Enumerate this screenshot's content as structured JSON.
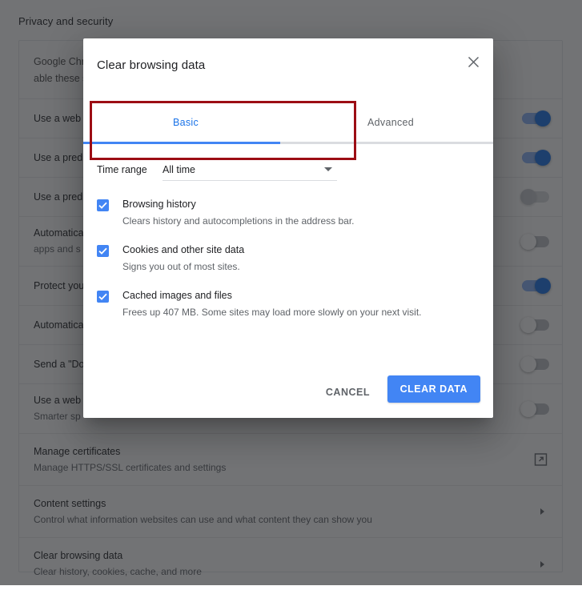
{
  "settings": {
    "page_title": "Privacy and security",
    "intro": {
      "text_before": "Google Chr",
      "text_after": "able these services. Le",
      "full_visible": "Google Chr...able these services. Le"
    },
    "rows": [
      {
        "title": "Use a web",
        "sub": "",
        "control": "toggle",
        "state": "on"
      },
      {
        "title": "Use a predi",
        "sub": "",
        "control": "toggle",
        "state": "on"
      },
      {
        "title": "Use a predi",
        "sub": "",
        "control": "toggle",
        "state": "off-disabled"
      },
      {
        "title": "Automatica",
        "sub": "apps and s",
        "control": "toggle",
        "state": "off"
      },
      {
        "title": "Protect you",
        "sub": "",
        "control": "toggle",
        "state": "on"
      },
      {
        "title": "Automatica",
        "sub": "",
        "control": "toggle",
        "state": "off"
      },
      {
        "title": "Send a \"Do",
        "sub": "",
        "control": "toggle",
        "state": "off"
      },
      {
        "title": "Use a web",
        "sub": "Smarter sp",
        "control": "toggle",
        "state": "off"
      },
      {
        "title": "Manage certificates",
        "sub": "Manage HTTPS/SSL certificates and settings",
        "control": "external-link",
        "state": ""
      },
      {
        "title": "Content settings",
        "sub": "Control what information websites can use and what content they can show you",
        "control": "arrow",
        "state": ""
      },
      {
        "title": "Clear browsing data",
        "sub": "Clear history, cookies, cache, and more",
        "control": "arrow",
        "state": ""
      }
    ]
  },
  "dialog": {
    "title": "Clear browsing data",
    "close_icon": "close-icon",
    "tabs": [
      {
        "label": "Basic",
        "active": true
      },
      {
        "label": "Advanced",
        "active": false
      }
    ],
    "progress_percent": 48,
    "time_range": {
      "label": "Time range",
      "value": "All time",
      "caret_icon": "chevron-down-icon"
    },
    "options": [
      {
        "title": "Browsing history",
        "sub": "Clears history and autocompletions in the address bar.",
        "checked": true
      },
      {
        "title": "Cookies and other site data",
        "sub": "Signs you out of most sites.",
        "checked": true
      },
      {
        "title": "Cached images and files",
        "sub": "Frees up 407 MB. Some sites may load more slowly on your next visit.",
        "checked": true
      }
    ],
    "actions": {
      "cancel_label": "CANCEL",
      "confirm_label": "CLEAR DATA"
    }
  },
  "annotation": {
    "color": "#9c0d14",
    "target": "time-range-section"
  },
  "colors": {
    "accent_blue": "#4285f4",
    "link_blue": "#1a73e8",
    "toggle_on": "#8ab4f8",
    "text_primary": "#202124",
    "text_secondary": "#5f6368",
    "annotation_red": "#9c0d14",
    "scrim": "rgba(32,33,36,0.63)"
  }
}
